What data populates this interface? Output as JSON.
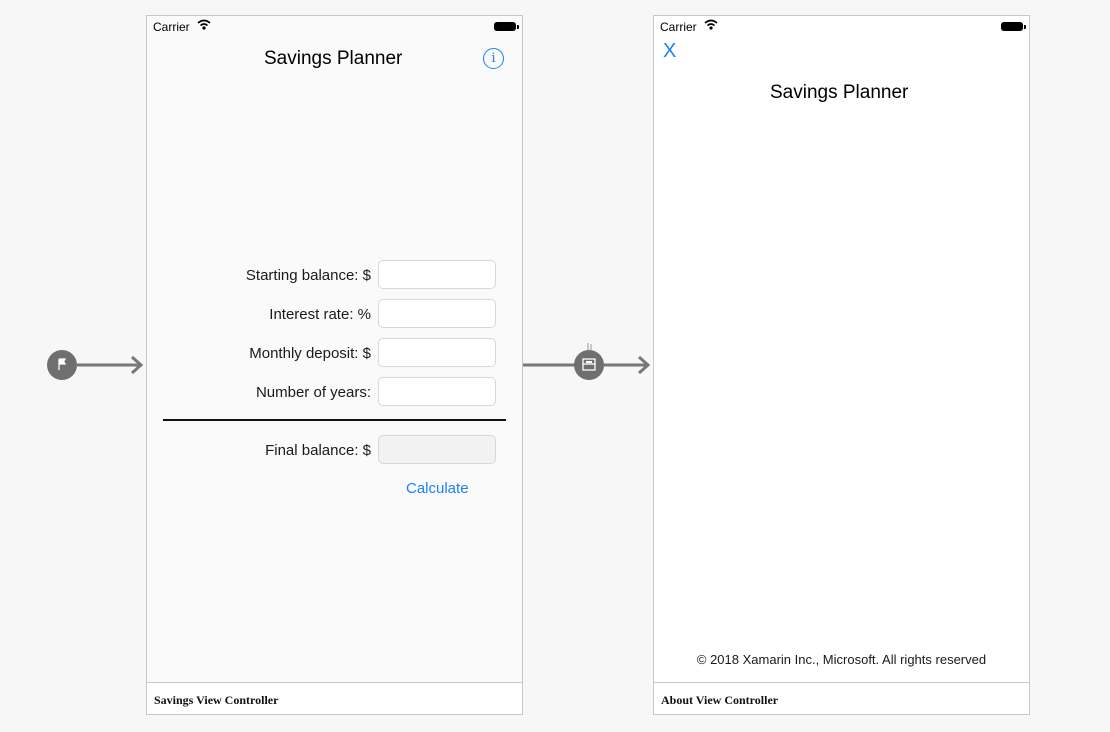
{
  "savings_scene": {
    "status_bar": {
      "carrier": "Carrier"
    },
    "title": "Savings Planner",
    "info_icon": "info-icon",
    "fields": [
      {
        "label": "Starting balance: $",
        "value": ""
      },
      {
        "label": "Interest rate: %",
        "value": ""
      },
      {
        "label": "Monthly deposit: $",
        "value": ""
      },
      {
        "label": "Number of years:",
        "value": ""
      }
    ],
    "result": {
      "label": "Final balance: $",
      "value": ""
    },
    "calculate_label": "Calculate",
    "footer": "Savings View Controller"
  },
  "about_scene": {
    "status_bar": {
      "carrier": "Carrier"
    },
    "close_label": "X",
    "title": "Savings Planner",
    "copyright": "© 2018 Xamarin Inc., Microsoft. All rights reserved",
    "footer": "About View Controller"
  },
  "colors": {
    "accent": "#1a82f7",
    "canvas": "#f7f7f7",
    "arrow": "#777777",
    "node": "#6f6f6f"
  }
}
